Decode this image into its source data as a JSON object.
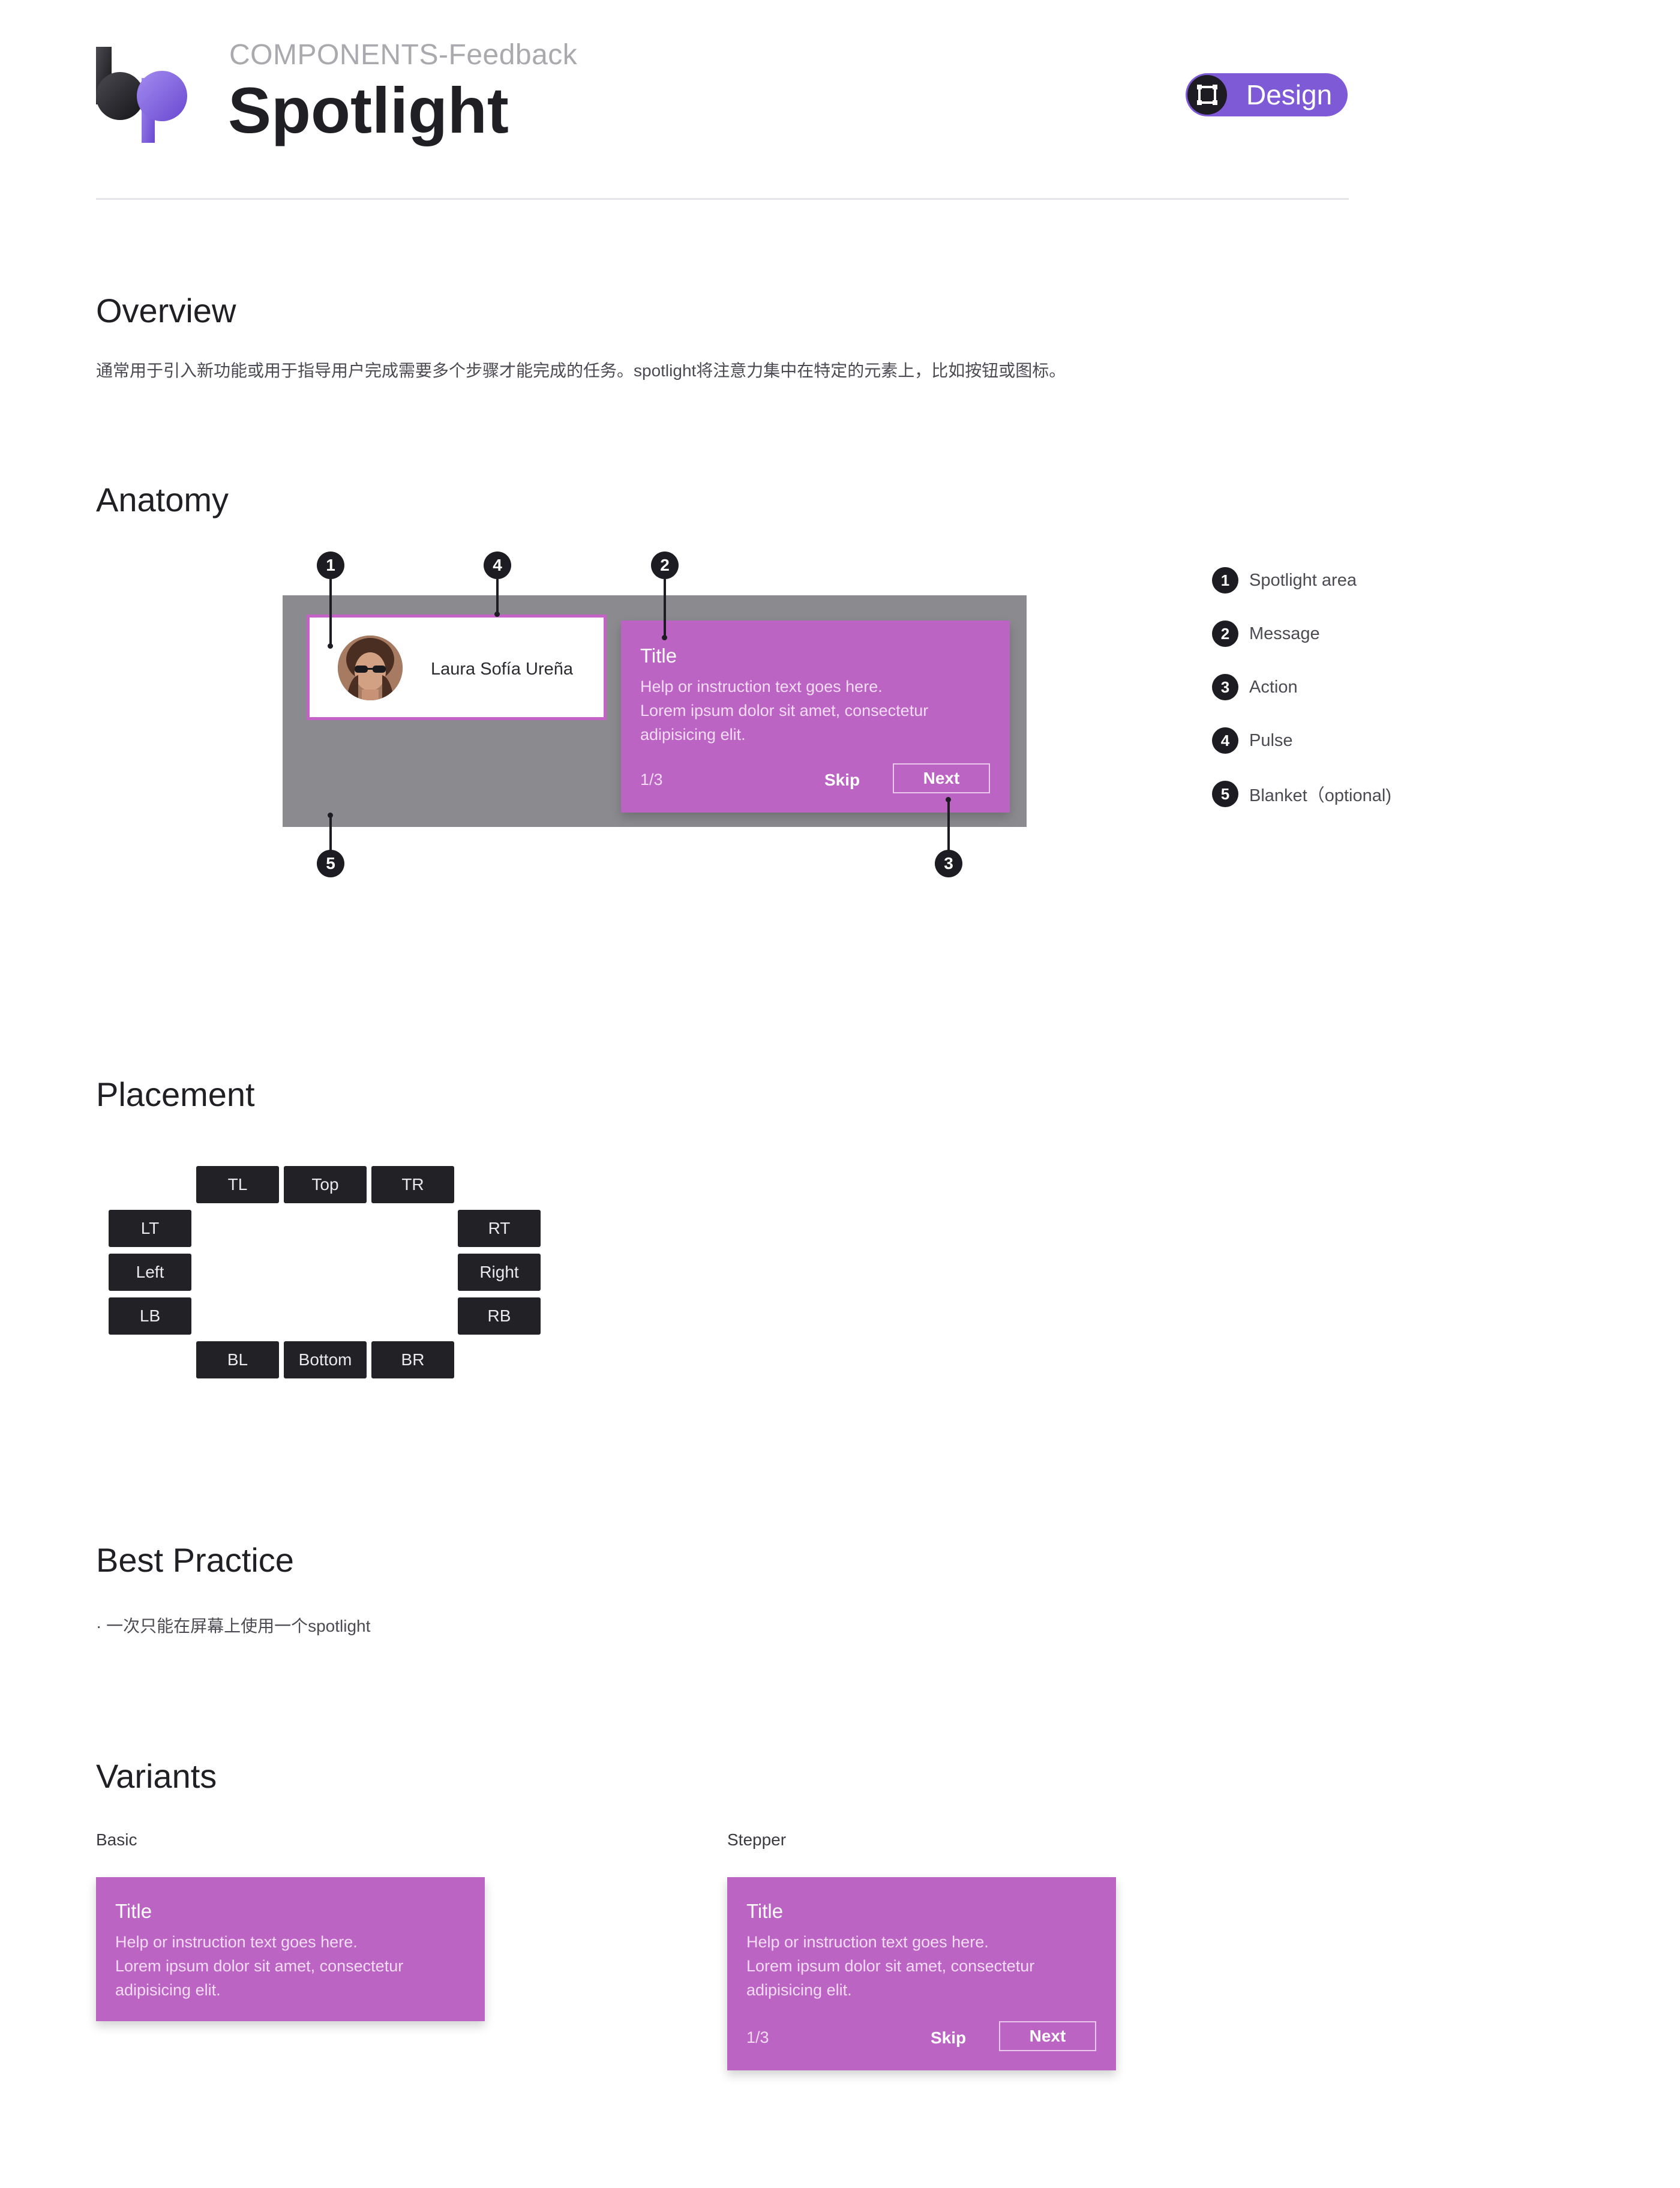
{
  "header": {
    "category": "COMPONENTS-Feedback",
    "title": "Spotlight",
    "tag": "Design"
  },
  "overview": {
    "heading": "Overview",
    "text": "通常用于引入新功能或用于指导用户完成需要多个步骤才能完成的任务。spotlight将注意力集中在特定的元素上，比如按钮或图标。"
  },
  "anatomy": {
    "heading": "Anatomy",
    "spotlight_name": "Laura Sofía Ureña",
    "message": {
      "title": "Title",
      "line1": "Help or  instruction text goes here.",
      "line2": "Lorem ipsum dolor sit amet, consectetur",
      "line3": "adipisicing elit.",
      "step": "1/3",
      "skip": "Skip",
      "next": "Next"
    },
    "markers": [
      "1",
      "2",
      "3",
      "4",
      "5"
    ],
    "legend": [
      {
        "num": "1",
        "label": "Spotlight area"
      },
      {
        "num": "2",
        "label": "Message"
      },
      {
        "num": "3",
        "label": "Action"
      },
      {
        "num": "4",
        "label": "Pulse"
      },
      {
        "num": "5",
        "label": "Blanket（optional)"
      }
    ]
  },
  "placement": {
    "heading": "Placement",
    "top": [
      "TL",
      "Top",
      "TR"
    ],
    "left": [
      "LT",
      "Left",
      "LB"
    ],
    "right": [
      "RT",
      "Right",
      "RB"
    ],
    "bottom": [
      "BL",
      "Bottom",
      "BR"
    ]
  },
  "best_practice": {
    "heading": "Best Practice",
    "items": [
      "· 一次只能在屏幕上使用一个spotlight"
    ]
  },
  "variants": {
    "heading": "Variants",
    "basic": {
      "label": "Basic",
      "title": "Title",
      "line1": "Help or  instruction text goes here.",
      "line2": "Lorem ipsum dolor sit amet, consectetur",
      "line3": "adipisicing elit."
    },
    "stepper": {
      "label": "Stepper",
      "title": "Title",
      "line1": "Help or  instruction text goes here.",
      "line2": "Lorem ipsum dolor sit amet, consectetur",
      "line3": "adipisicing elit.",
      "step": "1/3",
      "skip": "Skip",
      "next": "Next"
    }
  },
  "colors": {
    "accent": "#bc64c4",
    "brand_purple": "#7e5ad6",
    "blanket": "#8a8a8f",
    "dark": "#1c1c22"
  },
  "icons": {
    "logo": "bp-logo",
    "design_tag": "frame-icon"
  }
}
